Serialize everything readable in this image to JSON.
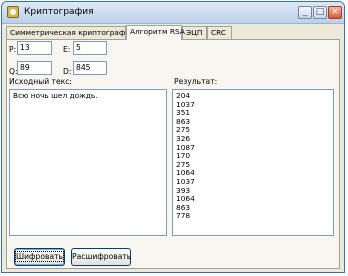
{
  "window": {
    "title": "Криптография"
  },
  "tabs": [
    {
      "label": "Симметрическая криптография"
    },
    {
      "label": "Алгоритм RSA"
    },
    {
      "label": "ЭЦП"
    },
    {
      "label": "CRC"
    }
  ],
  "rsa": {
    "p_label": "P:",
    "p_value": "13",
    "e_label": "E:",
    "e_value": "5",
    "q_label": "Q:",
    "q_value": "89",
    "d_label": "D:",
    "d_value": "845"
  },
  "source": {
    "label": "Исходный текс:",
    "text": "Всю ночь шел дождь."
  },
  "result": {
    "label": "Результат:",
    "values": [
      "204",
      "1037",
      "351",
      "863",
      "275",
      "326",
      "1087",
      "170",
      "275",
      "1064",
      "1037",
      "393",
      "1064",
      "863",
      "778"
    ]
  },
  "buttons": {
    "encrypt": "Шифровать",
    "decrypt": "Расшифровать"
  }
}
